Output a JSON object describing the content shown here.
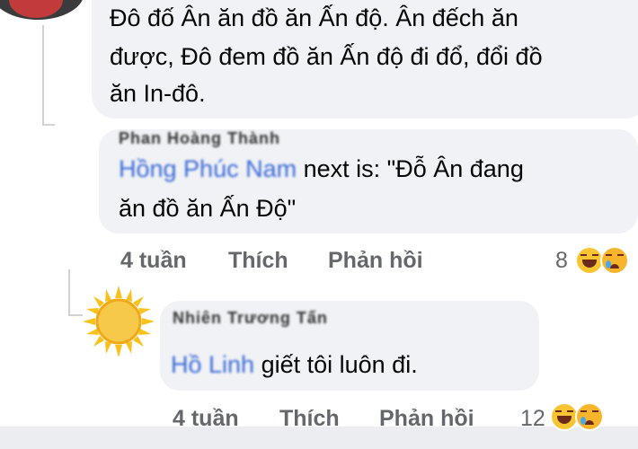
{
  "comments": [
    {
      "lines": [
        "Đô đố Ân ăn đồ ăn Ấn độ. Ân đếch ăn",
        "được, Đô đem đồ ăn Ấn độ đi đổ, đổi đồ",
        "ăn In-đô."
      ]
    },
    {
      "author": "Phan Hoàng Thành",
      "tagged": "Hồng Phúc Nam",
      "lines_rest": [
        " next is: \"Đỗ Ân đang",
        "ăn đồ ăn Ấn Độ\""
      ],
      "time": "4 tuần",
      "like": "Thích",
      "reply": "Phản hồi",
      "reaction_count": "8"
    },
    {
      "author": "Nhiên Trương Tấn",
      "tagged": "Hồ Linh",
      "text_rest": " giết tôi luôn đi.",
      "time": "4 tuần",
      "like": "Thích",
      "reply": "Phản hồi",
      "reaction_count": "12"
    }
  ],
  "colors": {
    "bubble": "#f0f2f5",
    "meta": "#65676b",
    "tag": "#3b69d8"
  },
  "icons": [
    "laugh-reaction-icon",
    "sad-reaction-icon",
    "sun-avatar-icon"
  ]
}
